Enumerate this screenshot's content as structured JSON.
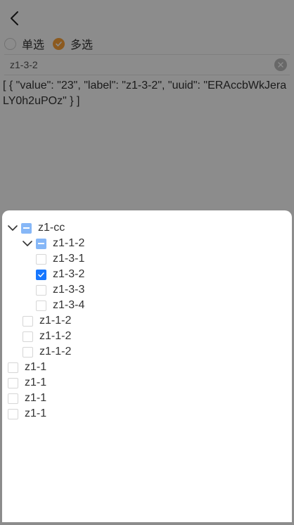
{
  "header": {
    "back_icon": "chevron-left-icon"
  },
  "mode": {
    "single_label": "单选",
    "multi_label": "多选",
    "selected": "multi",
    "accent": "#ffa43a"
  },
  "search": {
    "value": "z1-3-2"
  },
  "result": {
    "text": "[ { \"value\": \"23\", \"label\": \"z1-3-2\", \"uuid\": \"ERAccbWkJeraLY0h2uPOz\" } ]"
  },
  "tree": {
    "accent": "#1677ff",
    "nodes": [
      {
        "label": "z1-cc",
        "state": "partial",
        "expanded": true
      },
      {
        "label": "z1-1-2",
        "state": "partial",
        "expanded": true
      },
      {
        "label": "z1-3-1",
        "state": "unchecked"
      },
      {
        "label": "z1-3-2",
        "state": "checked"
      },
      {
        "label": "z1-3-3",
        "state": "unchecked"
      },
      {
        "label": "z1-3-4",
        "state": "unchecked"
      },
      {
        "label": "z1-1-2",
        "state": "unchecked"
      },
      {
        "label": "z1-1-2",
        "state": "unchecked"
      },
      {
        "label": "z1-1-2",
        "state": "unchecked"
      },
      {
        "label": "z1-1",
        "state": "unchecked"
      },
      {
        "label": "z1-1",
        "state": "unchecked"
      },
      {
        "label": "z1-1",
        "state": "unchecked"
      },
      {
        "label": "z1-1",
        "state": "unchecked"
      }
    ]
  }
}
